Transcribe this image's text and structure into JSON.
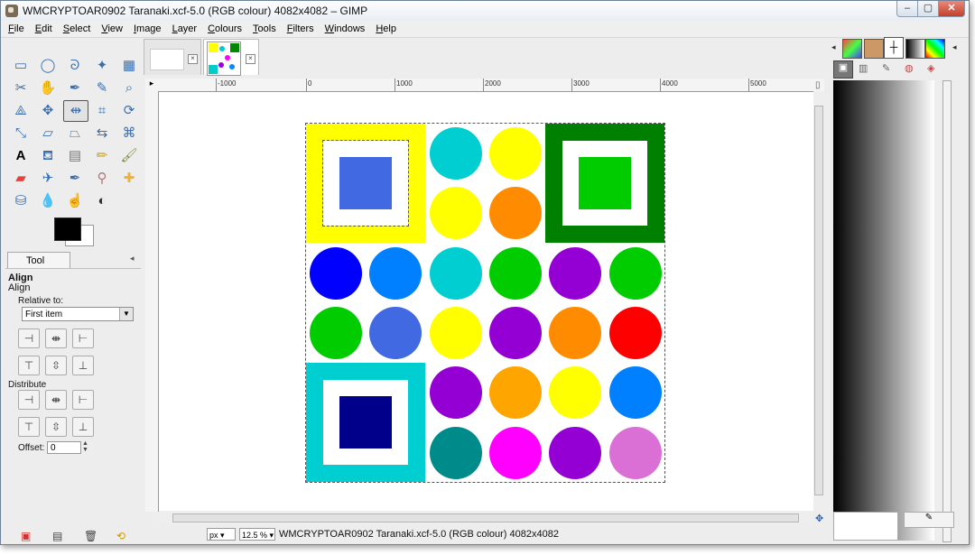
{
  "window": {
    "title": "WMCRYPTOAR0902 Taranaki.xcf-5.0 (RGB colour) 4082x4082 – GIMP",
    "min": "–",
    "max": "▢",
    "close": "✕"
  },
  "menu": [
    "File",
    "Edit",
    "Select",
    "View",
    "Image",
    "Layer",
    "Colours",
    "Tools",
    "Filters",
    "Windows",
    "Help"
  ],
  "tool_options": {
    "tab_label": "Tool Options",
    "heading": "Align",
    "subheading": "Align",
    "relative_to_label": "Relative to:",
    "relative_to_value": "First item",
    "distribute_label": "Distribute",
    "offset_label": "Offset:",
    "offset_value": "0"
  },
  "ruler": {
    "labels": [
      "-1000",
      "0",
      "1000",
      "2000",
      "3000",
      "4000",
      "5000"
    ]
  },
  "status": {
    "unit": "px",
    "zoom": "12.5 %",
    "text": "WMCRYPTOAR0902 Taranaki.xcf-5.0 (RGB colour) 4082x4082"
  },
  "colors": {
    "yellow": "#ffff00",
    "royal_blue": "#4169e1",
    "dark_green": "#008000",
    "green": "#00cc00",
    "cyan": "#00ced1",
    "navy": "#00008b",
    "blue": "#0000ff",
    "azure": "#0080ff",
    "orange": "#ff8c00",
    "purple": "#9400d3",
    "red": "#ff0000",
    "teal": "#008b8b",
    "magenta": "#ff00ff",
    "orchid": "#da70d6",
    "light_orange": "#ffa500"
  },
  "grid_dots": [
    {
      "row": 0,
      "col": 2,
      "color": "#00ced1"
    },
    {
      "row": 0,
      "col": 3,
      "color": "#ffff00"
    },
    {
      "row": 1,
      "col": 2,
      "color": "#ffff00"
    },
    {
      "row": 1,
      "col": 3,
      "color": "#ff8c00"
    },
    {
      "row": 2,
      "col": 0,
      "color": "#0000ff"
    },
    {
      "row": 2,
      "col": 1,
      "color": "#0080ff"
    },
    {
      "row": 2,
      "col": 2,
      "color": "#00ced1"
    },
    {
      "row": 2,
      "col": 3,
      "color": "#00cc00"
    },
    {
      "row": 2,
      "col": 4,
      "color": "#9400d3"
    },
    {
      "row": 2,
      "col": 5,
      "color": "#00cc00"
    },
    {
      "row": 3,
      "col": 0,
      "color": "#00cc00"
    },
    {
      "row": 3,
      "col": 1,
      "color": "#4169e1"
    },
    {
      "row": 3,
      "col": 2,
      "color": "#ffff00"
    },
    {
      "row": 3,
      "col": 3,
      "color": "#9400d3"
    },
    {
      "row": 3,
      "col": 4,
      "color": "#ff8c00"
    },
    {
      "row": 3,
      "col": 5,
      "color": "#ff0000"
    },
    {
      "row": 4,
      "col": 2,
      "color": "#9400d3"
    },
    {
      "row": 4,
      "col": 3,
      "color": "#ffa500"
    },
    {
      "row": 4,
      "col": 4,
      "color": "#ffff00"
    },
    {
      "row": 4,
      "col": 5,
      "color": "#0080ff"
    },
    {
      "row": 5,
      "col": 2,
      "color": "#008b8b"
    },
    {
      "row": 5,
      "col": 3,
      "color": "#ff00ff"
    },
    {
      "row": 5,
      "col": 4,
      "color": "#9400d3"
    },
    {
      "row": 5,
      "col": 5,
      "color": "#da70d6"
    }
  ]
}
